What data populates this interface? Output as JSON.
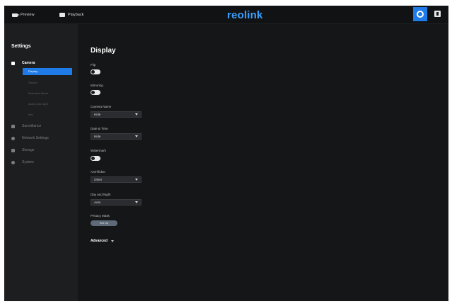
{
  "topbar": {
    "preview_label": "Preview",
    "playback_label": "Playback",
    "logo": "reolink",
    "accent_color": "#1f7be8"
  },
  "sidebar": {
    "title": "Settings",
    "items": [
      {
        "label": "Camera",
        "icon": "camera-icon",
        "active": true
      },
      {
        "label": "Surveillance",
        "icon": "surveillance-icon",
        "active": false
      },
      {
        "label": "Network Settings",
        "icon": "network-icon",
        "active": false
      },
      {
        "label": "Storage",
        "icon": "storage-icon",
        "active": false
      },
      {
        "label": "System",
        "icon": "system-icon",
        "active": false
      }
    ],
    "sub_items": [
      {
        "label": "Display",
        "active": true
      },
      {
        "label": "Stream",
        "active": false
      },
      {
        "label": "Detection Alarm",
        "active": false
      },
      {
        "label": "Audio and Light",
        "active": false
      },
      {
        "label": "Info",
        "active": false
      }
    ]
  },
  "main": {
    "title": "Display",
    "flip_label": "Flip",
    "mirroring_label": "Mirroring",
    "camera_name_label": "Camera Name",
    "camera_name_value": "Hide",
    "date_time_label": "Date & Time",
    "date_time_value": "Hide",
    "watermark_label": "Watermark",
    "anti_flicker_label": "Anti-flicker",
    "anti_flicker_value": "Other",
    "day_night_label": "Day and Night",
    "day_night_value": "Auto",
    "privacy_mask_label": "Privacy Mask",
    "privacy_mask_button": "Set Up",
    "advanced_label": "Advanced"
  }
}
